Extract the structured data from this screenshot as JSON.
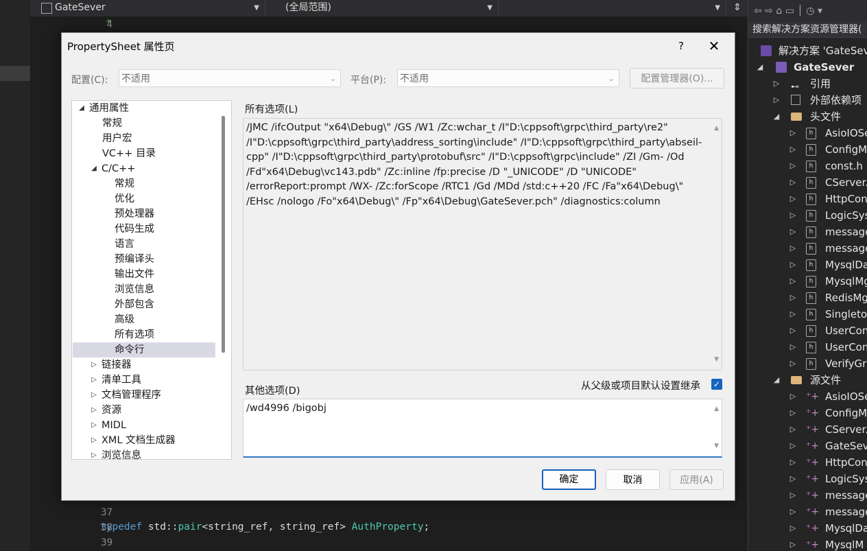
{
  "ide": {
    "project_dropdown": "GateSever",
    "scope_dropdown": "(全局范围)",
    "line_numbers": [
      "4",
      "37",
      "38",
      "39"
    ],
    "code_line_38": {
      "keyword": "typedef",
      "ns": " std::",
      "type": "pair",
      "args": "<string_ref, string_ref> ",
      "name": "AuthProperty",
      "end": ";"
    }
  },
  "solution_explorer": {
    "search": "搜索解决方案资源管理器(",
    "solution": "解决方案 'GateSev",
    "project": "GateSever",
    "references": "引用",
    "external_deps": "外部依赖项",
    "headers_folder": "头文件",
    "header_files": [
      "AsioIOSe",
      "ConfigM",
      "const.h",
      "CServer.",
      "HttpCon",
      "LogicSys",
      "message",
      "message",
      "MysqlDa",
      "MysqlMg",
      "RedisMg",
      "Singleto",
      "UserCon",
      "UserCon",
      "VerifyGrp"
    ],
    "sources_folder": "源文件",
    "source_files": [
      "AsioIOSe",
      "ConfigM",
      "CServer.",
      "GateSev",
      "HttpCon",
      "LogicSys",
      "message",
      "message",
      "MysqlDa",
      "MysqlM"
    ]
  },
  "dialog": {
    "title": "PropertySheet 属性页",
    "help": "?",
    "close": "✕",
    "config_label": "配置(C):",
    "config_value": "不适用",
    "platform_label": "平台(P):",
    "platform_value": "不适用",
    "config_manager": "配置管理器(O)...",
    "tree": {
      "root": "通用属性",
      "items": [
        "常规",
        "用户宏",
        "VC++ 目录"
      ],
      "cpp": "C/C++",
      "cpp_items": [
        "常规",
        "优化",
        "预处理器",
        "代码生成",
        "语言",
        "预编译头",
        "输出文件",
        "浏览信息",
        "外部包含",
        "高级",
        "所有选项",
        "命令行"
      ],
      "after": [
        "链接器",
        "清单工具",
        "文档管理程序",
        "资源",
        "MIDL",
        "XML 文档生成器",
        "浏览信息"
      ]
    },
    "all_options_label": "所有选项(L)",
    "all_options_text": "/JMC /ifcOutput \"x64\\Debug\\\" /GS /W1 /Zc:wchar_t /I\"D:\\cppsoft\\grpc\\third_party\\re2\" /I\"D:\\cppsoft\\grpc\\third_party\\address_sorting\\include\" /I\"D:\\cppsoft\\grpc\\third_party\\abseil-cpp\" /I\"D:\\cppsoft\\grpc\\third_party\\protobuf\\src\" /I\"D:\\cppsoft\\grpc\\include\" /ZI /Gm- /Od /Fd\"x64\\Debug\\vc143.pdb\" /Zc:inline /fp:precise /D \"_UNICODE\" /D \"UNICODE\" /errorReport:prompt /WX- /Zc:forScope /RTC1 /Gd /MDd /std:c++20 /FC /Fa\"x64\\Debug\\\" /EHsc /nologo /Fo\"x64\\Debug\\\" /Fp\"x64\\Debug\\GateSever.pch\" /diagnostics:column",
    "other_options_label": "其他选项(D)",
    "inherit_label": "从父级或项目默认设置继承",
    "other_options_value": "/wd4996 /bigobj",
    "ok": "确定",
    "cancel": "取消",
    "apply": "应用(A)"
  }
}
